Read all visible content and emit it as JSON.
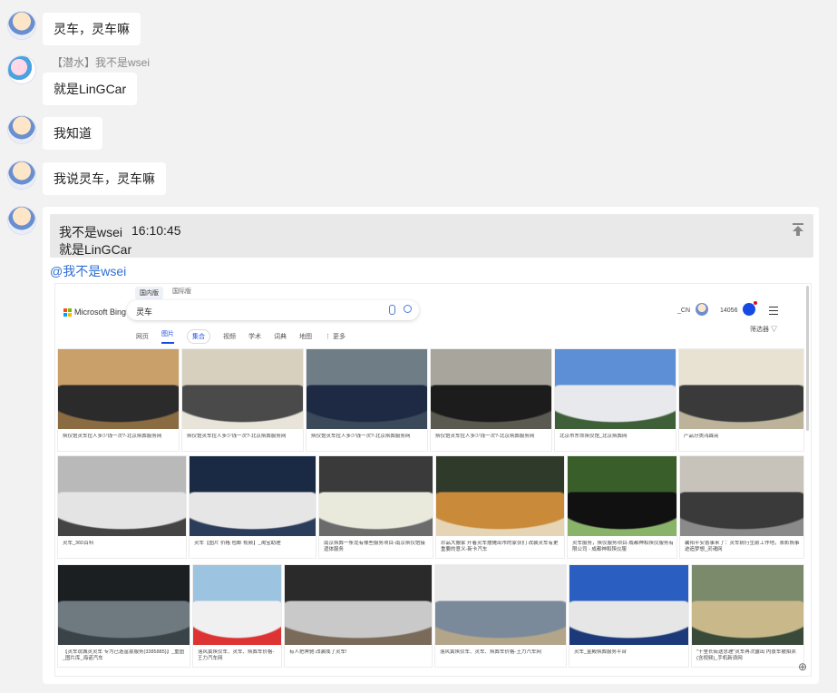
{
  "messages": [
    {
      "text": "灵车，灵车嘛"
    },
    {
      "nickname": "【潜水】我不是wsei",
      "text": "就是LinGCar"
    },
    {
      "text": "我知道"
    },
    {
      "text": "我说灵车，灵车嘛"
    }
  ],
  "reply": {
    "quote_author": "我不是wsei",
    "quote_time": "16:10:45",
    "quote_text": "就是LinGCar",
    "mention": "@我不是wsei"
  },
  "bing": {
    "region_tabs": [
      "国内版",
      "国际版"
    ],
    "logo": "Microsoft Bing",
    "query": "灵车",
    "nav": {
      "web": "网页",
      "images": "图片",
      "all": "集合",
      "videos": "视频",
      "academic": "学术",
      "dict": "词典",
      "maps": "地图",
      "more": "更多"
    },
    "user": "_CN",
    "points": "14056",
    "filter": "筛选器",
    "results": [
      {
        "caption": "殡仪馆灵车拉人多少钱一次?-北京殡葬服务网",
        "colors": [
          "#c9a06a",
          "#2b2b2b",
          "#8a6b42"
        ]
      },
      {
        "caption": "殡仪馆灵车拉人多少钱一次?-北京殡葬服务网",
        "colors": [
          "#d8d0bf",
          "#4a4a4a",
          "#e8e4da"
        ]
      },
      {
        "caption": "殡仪馆灵车拉人多少钱一次?-北京殡葬服务网",
        "colors": [
          "#6f7d86",
          "#1e2a44",
          "#3b4a5a"
        ]
      },
      {
        "caption": "殡仪馆灵车拉人多少钱一次?-北京殡葬服务网",
        "colors": [
          "#a8a59c",
          "#1c1c1c",
          "#5a5a50"
        ]
      },
      {
        "caption": "北京市东郊殡仪馆_北京殡葬网",
        "colors": [
          "#5c8fd6",
          "#e7e9ec",
          "#3e5f37"
        ]
      },
      {
        "caption": "产品分类鸿霖亮",
        "colors": [
          "#e8e2d3",
          "#3a3a3a",
          "#bcb39a"
        ]
      },
      {
        "caption": "灵车_360百科",
        "colors": [
          "#b9b9b9",
          "#e4e4e4",
          "#444"
        ]
      },
      {
        "caption": "灵车【图片 价格 包邮 视频】_淘宝助理",
        "colors": [
          "#1b2a44",
          "#e6e6e6",
          "#2c3d5c"
        ]
      },
      {
        "caption": "南京殡葬一条龙有哪些服务项目-南京殡仪馆接遗体服务",
        "colors": [
          "#3a3a3a",
          "#e9e9dc",
          "#6b6b6b"
        ]
      },
      {
        "caption": "珍品大搬家 开着灵车摆摊出市的家伙们 改装灵车有更重要的意义-新卡汽车",
        "colors": [
          "#2f3a2a",
          "#c98a3a",
          "#e6d5b5"
        ]
      },
      {
        "caption": "灵车服务，殡仪服务项目-成都神和殡仪服务有限公司 - 成都神和殡仪服",
        "colors": [
          "#3a5e2a",
          "#111",
          "#8ab36a"
        ]
      },
      {
        "caption": "襄阳平安喜事来了：灵车病行生前工作地，表彰照事迹造梦想_灵魂网",
        "colors": [
          "#c7c3bb",
          "#3a3a3a",
          "#8a8a8a"
        ]
      },
      {
        "caption": "【灵车说城灵灵车 专为已逝富豪服务(3385885)】_重图_图片库_海诺汽车",
        "colors": [
          "#1c1f22",
          "#6e7a80",
          "#3a4448"
        ]
      },
      {
        "caption": "落风黄殡仪车、灵车、殡葬车价格-王力汽车网",
        "colors": [
          "#9cc3e0",
          "#f0f0f0",
          "#d33"
        ]
      },
      {
        "caption": "有人把奔驰 改装成了灵车!",
        "colors": [
          "#2a2a2a",
          "#c9c9c9",
          "#7a6a5a"
        ]
      },
      {
        "caption": "落风黄殡仪车、灵车、殡葬车价格-王力汽车网",
        "colors": [
          "#e9e9e9",
          "#7a8a9a",
          "#b3a58a"
        ]
      },
      {
        "caption": "灵车_金殿殡葬服务平台",
        "colors": [
          "#2a5ec0",
          "#e6e6e6",
          "#1c3a7a"
        ]
      },
      {
        "caption": "\"十里长街送总理\"灵车再次露出 内景车被拍卖 (含视频)_手机新浪网",
        "colors": [
          "#7a8a6a",
          "#c9b98a",
          "#3a4a3a"
        ]
      }
    ]
  }
}
